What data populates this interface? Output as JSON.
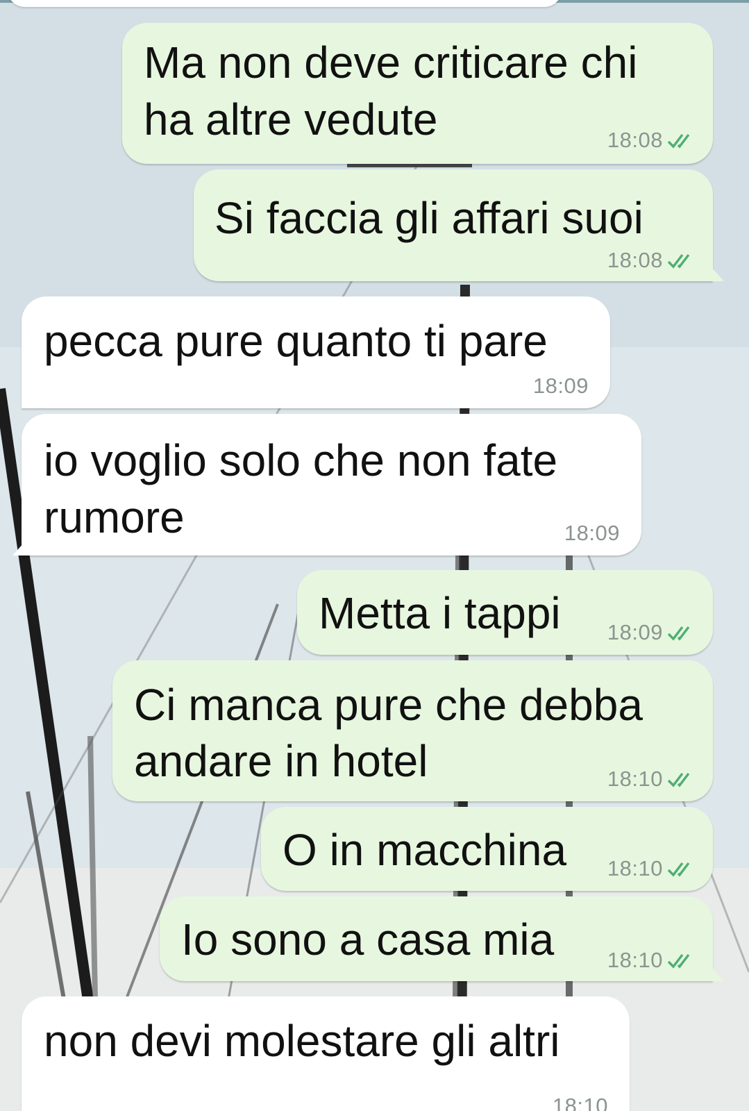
{
  "colors": {
    "outgoing_bubble": "#e7f7df",
    "incoming_bubble": "#ffffff",
    "read_ticks": "#4fae73",
    "time_text": "#8a9490"
  },
  "icons": {
    "read_receipt": "double-check-icon"
  },
  "messages": [
    {
      "direction": "outgoing",
      "lines": [
        "Ma non deve criticare chi",
        "ha altre vedute"
      ],
      "time": "18:08",
      "read": true
    },
    {
      "direction": "outgoing",
      "lines": [
        "Si faccia gli affari suoi"
      ],
      "time": "18:08",
      "read": true
    },
    {
      "direction": "incoming",
      "lines": [
        "pecca pure quanto ti pare"
      ],
      "time": "18:09"
    },
    {
      "direction": "incoming",
      "lines": [
        "io voglio solo che non fate",
        "rumore"
      ],
      "time": "18:09"
    },
    {
      "direction": "outgoing",
      "lines": [
        "Metta i tappi"
      ],
      "time": "18:09",
      "read": true
    },
    {
      "direction": "outgoing",
      "lines": [
        "Ci manca pure che debba",
        "andare in hotel"
      ],
      "time": "18:10",
      "read": true
    },
    {
      "direction": "outgoing",
      "lines": [
        "O in macchina"
      ],
      "time": "18:10",
      "read": true
    },
    {
      "direction": "outgoing",
      "lines": [
        "Io sono a casa mia"
      ],
      "time": "18:10",
      "read": true
    },
    {
      "direction": "incoming",
      "lines": [
        "non devi molestare gli altri"
      ],
      "time": "18:10"
    }
  ]
}
